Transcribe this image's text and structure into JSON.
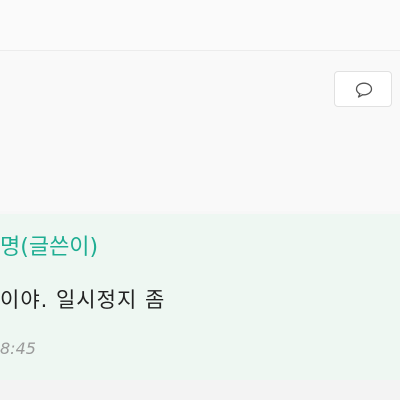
{
  "comment_button": {
    "icon": "speech-bubble-icon"
  },
  "comment": {
    "author": "명(글쓴이)",
    "message": "이야. 일시정지 좀",
    "timestamp": "8:45"
  },
  "colors": {
    "author": "#1fae93",
    "comment_background": "#eef7f2"
  }
}
